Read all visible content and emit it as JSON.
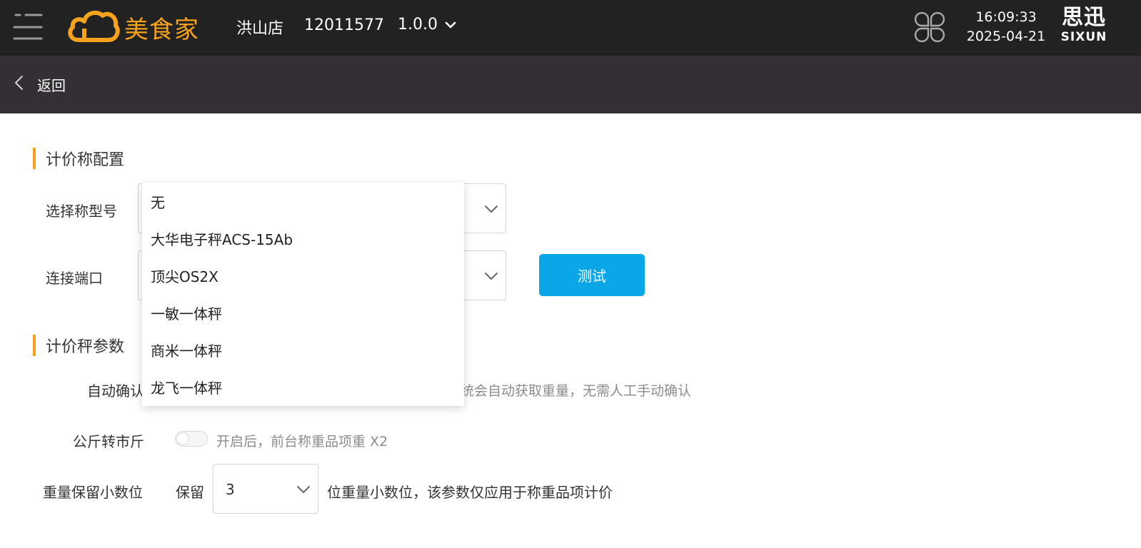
{
  "header": {
    "app_name": "美食家",
    "store_name": "洪山店",
    "store_id": "12011577",
    "version": "1.0.0",
    "time": "16:09:33",
    "date": "2025-04-21",
    "brand_cn": "思迅",
    "brand_en": "SIXUN",
    "colors": {
      "bar_bg": "#222222",
      "logo": "#f7a21b"
    },
    "icons": [
      "menu-icon",
      "cloud-logo-icon",
      "chevron-down-icon",
      "apps-grid-icon"
    ]
  },
  "subbar": {
    "back_label": "返回",
    "icons": [
      "chevron-left-icon"
    ],
    "bg": "#332f34"
  },
  "scale_config": {
    "title": "计价称配置",
    "model_label": "选择称型号",
    "port_label": "连接端口",
    "test_button": "测试",
    "accent": "#f7a21b",
    "button_color": "#0aa6e8"
  },
  "scale_params": {
    "title": "计价秤参数",
    "auto_confirm_label": "自动确认",
    "auto_confirm_hint": "系统会自动获取重量，无需人工手动确认",
    "jin_label": "公斤转市斤",
    "jin_hint": "开启后，前台称重品项重 X2",
    "jin_enabled": false,
    "decimal_label": "重量保留小数位",
    "decimal_prefix": "保留",
    "decimal_value": "3",
    "decimal_suffix": "位重量小数位，该参数仅应用于称重品项计价"
  },
  "model_dropdown": {
    "options": [
      "无",
      "大华电子秤ACS-15Ab",
      "顶尖OS2X",
      "一敏一体秤",
      "商米一体秤",
      "龙飞一体秤"
    ]
  }
}
